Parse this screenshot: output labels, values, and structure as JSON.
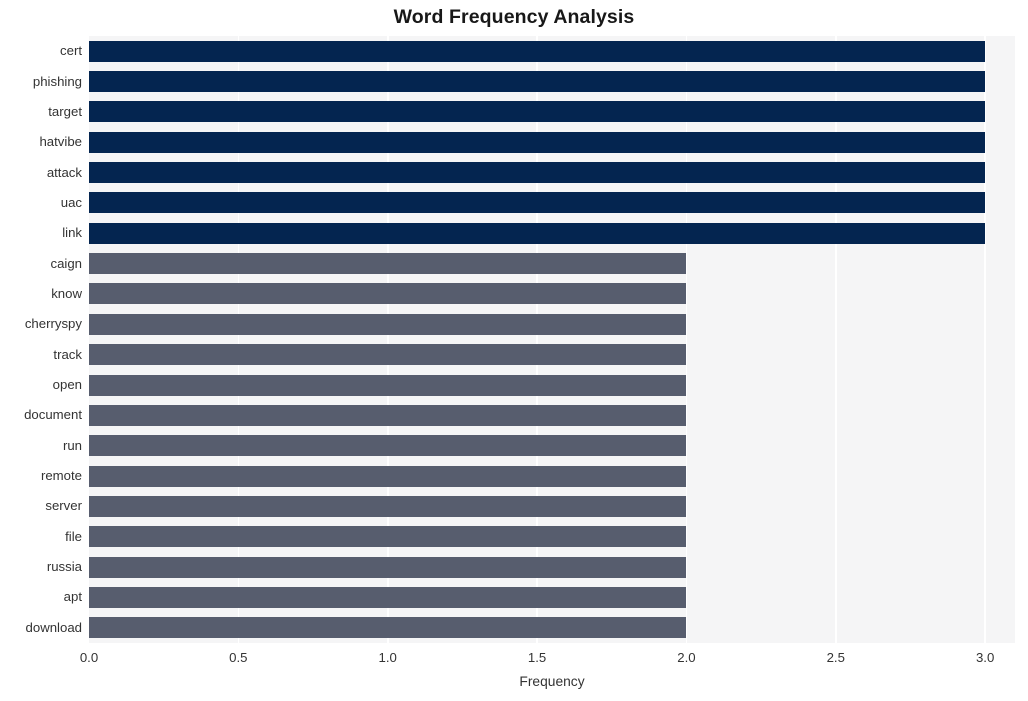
{
  "chart_data": {
    "type": "bar",
    "orientation": "horizontal",
    "title": "Word Frequency Analysis",
    "xlabel": "Frequency",
    "ylabel": "",
    "xlim": [
      0.0,
      3.1
    ],
    "xticks": [
      "0.0",
      "0.5",
      "1.0",
      "1.5",
      "2.0",
      "2.5",
      "3.0"
    ],
    "xtick_values": [
      0.0,
      0.5,
      1.0,
      1.5,
      2.0,
      2.5,
      3.0
    ],
    "grid": "vertical-white-on-light-gray",
    "legend": "none",
    "categories": [
      "cert",
      "phishing",
      "target",
      "hatvibe",
      "attack",
      "uac",
      "link",
      "caign",
      "know",
      "cherryspy",
      "track",
      "open",
      "document",
      "run",
      "remote",
      "server",
      "file",
      "russia",
      "apt",
      "download"
    ],
    "values": [
      3,
      3,
      3,
      3,
      3,
      3,
      3,
      2,
      2,
      2,
      2,
      2,
      2,
      2,
      2,
      2,
      2,
      2,
      2,
      2
    ],
    "bar_colors": [
      "#042550",
      "#042550",
      "#042550",
      "#042550",
      "#042550",
      "#042550",
      "#042550",
      "#575d6e",
      "#575d6e",
      "#575d6e",
      "#575d6e",
      "#575d6e",
      "#575d6e",
      "#575d6e",
      "#575d6e",
      "#575d6e",
      "#575d6e",
      "#575d6e",
      "#575d6e",
      "#575d6e"
    ]
  },
  "style": {
    "figure_background": "#ffffff",
    "axes_background": "#f5f5f6",
    "gridline_color": "#ffffff",
    "tick_label_color": "#333333",
    "title_color": "#181818",
    "high_value_color": "#042550",
    "low_value_color": "#575d6e"
  }
}
